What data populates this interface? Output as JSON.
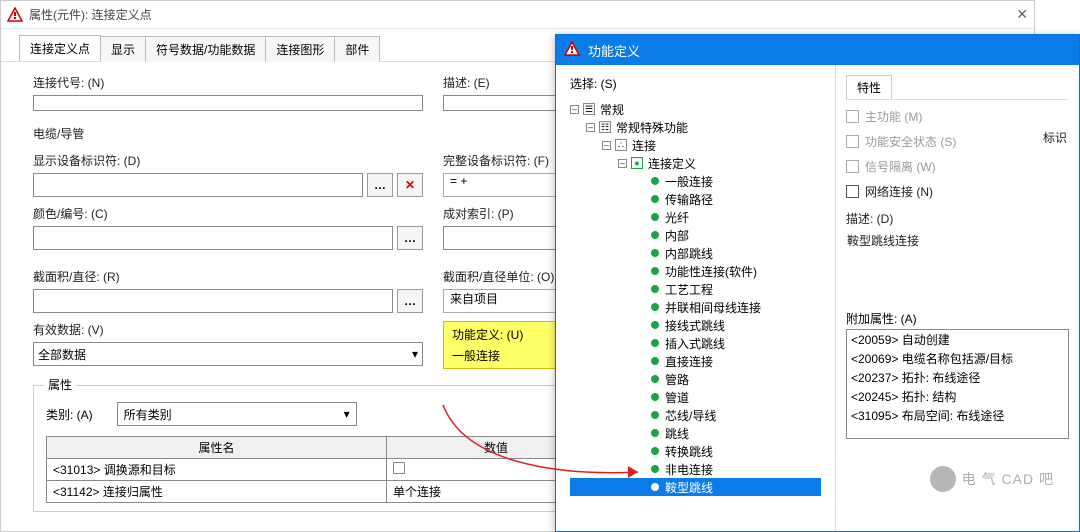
{
  "left_dialog": {
    "title": "属性(元件): 连接定义点",
    "tabs": [
      "连接定义点",
      "显示",
      "符号数据/功能数据",
      "连接图形",
      "部件"
    ],
    "labels": {
      "code": "连接代号: (N)",
      "desc": "描述: (E)",
      "cable": "电缆/导管",
      "show_dt": "显示设备标识符: (D)",
      "full_dt": "完整设备标识符: (F)",
      "full_dt_value": "= +",
      "color": "颜色/编号: (C)",
      "pair_idx": "成对索引: (P)",
      "section": "截面积/直径: (R)",
      "section_unit": "截面积/直径单位: (O)",
      "section_unit_value": "来自项目",
      "valid_data": "有效数据: (V)",
      "valid_data_value": "全部数据",
      "highlight1": "功能定义: (U)",
      "highlight2": "一般连接",
      "props_group": "属性",
      "category": "类别: (A)",
      "category_value": "所有类别",
      "col_name": "属性名",
      "col_value": "数值"
    },
    "table": [
      {
        "name": "<31013> 调换源和目标",
        "value": ""
      },
      {
        "name": "<31142> 连接归属性",
        "value": "单个连接"
      }
    ]
  },
  "right_dialog": {
    "title": "功能定义",
    "select_label": "选择: (S)",
    "tree": {
      "l0": "常规",
      "l1": "常规特殊功能",
      "l2": "连接",
      "l3": "连接定义",
      "leaves": [
        "一般连接",
        "传输路径",
        "光纤",
        "内部",
        "内部跳线",
        "功能性连接(软件)",
        "工艺工程",
        "并联相间母线连接",
        "接线式跳线",
        "插入式跳线",
        "直接连接",
        "管路",
        "管道",
        "芯线/导线",
        "跳线",
        "转换跳线",
        "非电连接",
        "鞍型跳线"
      ]
    },
    "prop": {
      "tab": "特性",
      "chks": {
        "main": "主功能 (M)",
        "safety": "功能安全状态 (S)",
        "signal": "信号隔离 (W)",
        "net": "网络连接 (N)"
      },
      "ident_cut": "标识",
      "desc_label": "描述: (D)",
      "desc_value": "鞍型跳线连接",
      "addprop_label": "附加属性: (A)",
      "addprops": [
        "<20059> 自动创建",
        "<20069> 电缆名称包括源/目标",
        "<20237> 拓扑: 布线途径",
        "<20245> 拓扑: 结构",
        "<31095> 布局空间: 布线途径"
      ]
    }
  }
}
